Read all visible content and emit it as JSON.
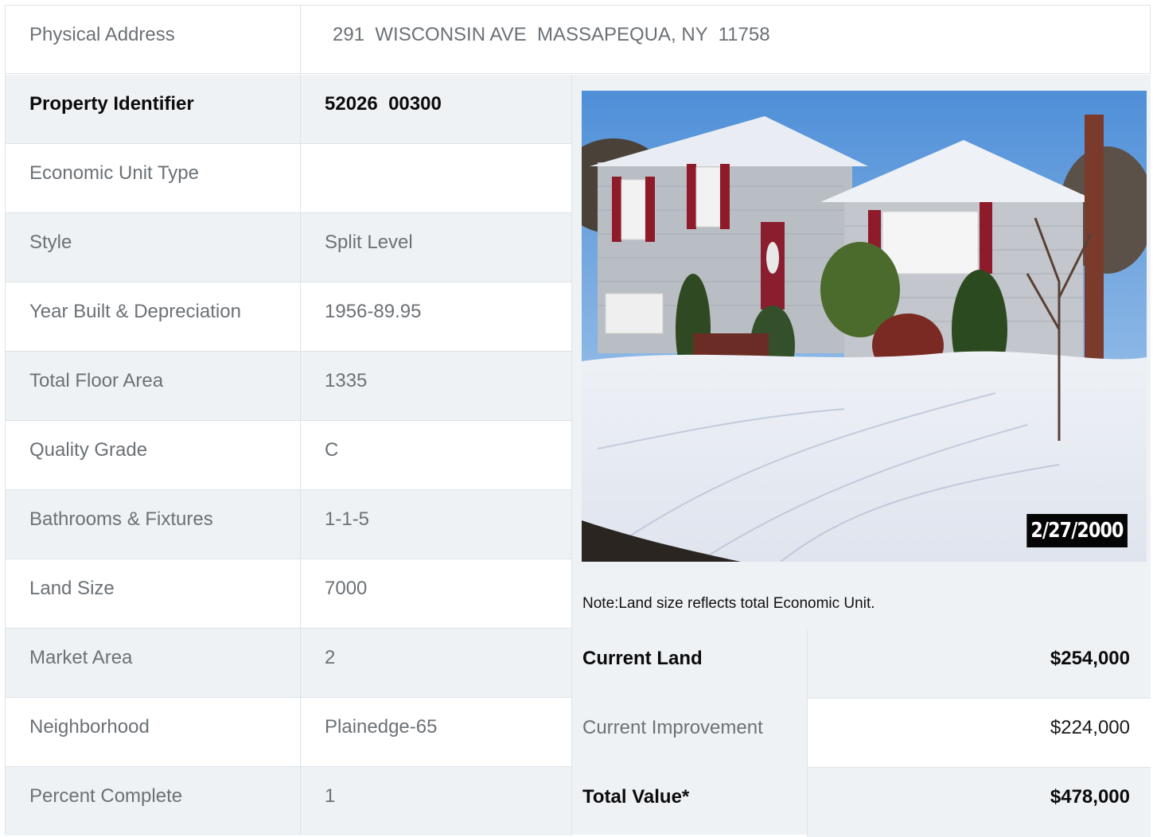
{
  "address": {
    "label": "Physical Address",
    "value": "291  WISCONSIN AVE  MASSAPEQUA, NY  11758"
  },
  "property_rows": [
    {
      "label": "Property Identifier",
      "value": "52026  00300"
    },
    {
      "label": "Economic Unit Type",
      "value": ""
    },
    {
      "label": "Style",
      "value": "Split Level"
    },
    {
      "label": "Year Built & Depreciation",
      "value": "1956-89.95"
    },
    {
      "label": "Total Floor Area",
      "value": "1335"
    },
    {
      "label": "Quality Grade",
      "value": "C"
    },
    {
      "label": "Bathrooms & Fixtures",
      "value": "1-1-5"
    },
    {
      "label": "Land Size",
      "value": "7000"
    },
    {
      "label": "Market Area",
      "value": "2"
    },
    {
      "label": "Neighborhood",
      "value": "Plainedge-65"
    },
    {
      "label": "Percent Complete",
      "value": "1"
    }
  ],
  "photo": {
    "date_stamp": "2/27/2000"
  },
  "note": "Note:Land size reflects total Economic Unit.",
  "values": [
    {
      "label": "Current Land",
      "value": "$254,000"
    },
    {
      "label": "Current Improvement",
      "value": "$224,000"
    },
    {
      "label": "Total Value*",
      "value": "$478,000"
    }
  ],
  "colors": {
    "row_alt": "#eff2f5",
    "border": "#dfe3e6",
    "muted_text": "#6b7176",
    "siding": "#b9bdc4",
    "shutter": "#8e1a2a"
  }
}
